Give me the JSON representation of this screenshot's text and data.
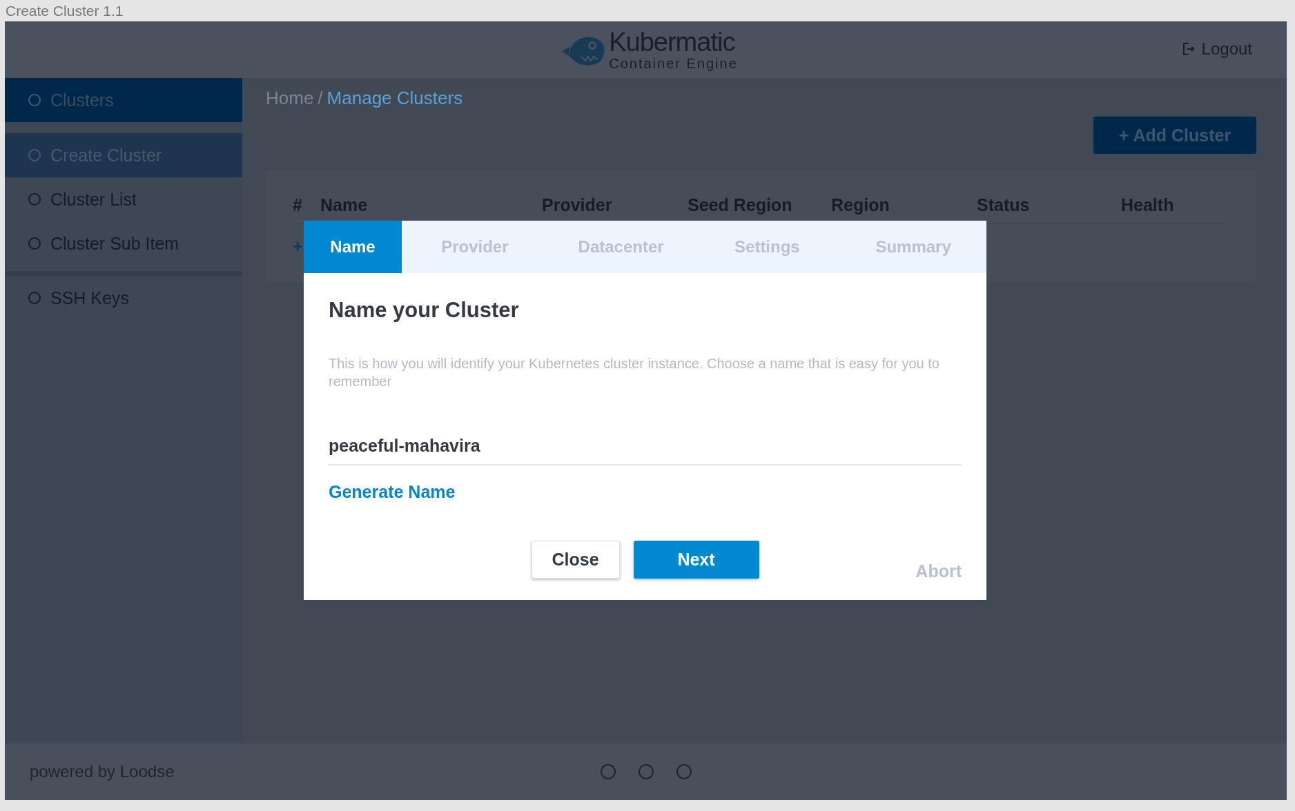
{
  "window": {
    "title": "Create Cluster 1.1"
  },
  "header": {
    "logo_title": "Kubermatic",
    "logo_subtitle": "Container Engine",
    "logout": "Logout"
  },
  "sidebar": {
    "items": [
      {
        "label": "Clusters",
        "selected": true,
        "children": [
          {
            "label": "Create Cluster",
            "selected": true
          },
          {
            "label": "Cluster List",
            "selected": false
          },
          {
            "label": "Cluster Sub Item",
            "selected": false
          }
        ]
      },
      {
        "label": "SSH Keys",
        "selected": false
      }
    ]
  },
  "breadcrumb": {
    "separator": "/",
    "items": [
      {
        "label": "Home",
        "current": false
      },
      {
        "label": "Manage Clusters",
        "current": true
      }
    ]
  },
  "add_button": "+ Add Cluster",
  "table": {
    "columns": [
      "#",
      "Name",
      "Provider",
      "Seed Region",
      "Region",
      "Status",
      "Health"
    ],
    "rows": [
      [
        "+"
      ]
    ]
  },
  "dialog": {
    "steps": [
      {
        "label": "Name",
        "selected": true
      },
      {
        "label": "Provider",
        "selected": false
      },
      {
        "label": "Datacenter",
        "selected": false
      },
      {
        "label": "Settings",
        "selected": false
      },
      {
        "label": "Summary",
        "selected": false
      }
    ],
    "title": "Name your Cluster",
    "description": "This is how you will identify your Kubernetes cluster instance. Choose a name that is easy for you to remember",
    "name_field": {
      "value": "peaceful-mahavira"
    },
    "generate_link": "Generate Name",
    "buttons": [
      {
        "label": "Close",
        "kind": "secondary"
      },
      {
        "label": "Next",
        "kind": "primary"
      },
      {
        "label": "Abort",
        "kind": "link"
      }
    ]
  },
  "footer": {
    "text": "powered by Loodse"
  }
}
